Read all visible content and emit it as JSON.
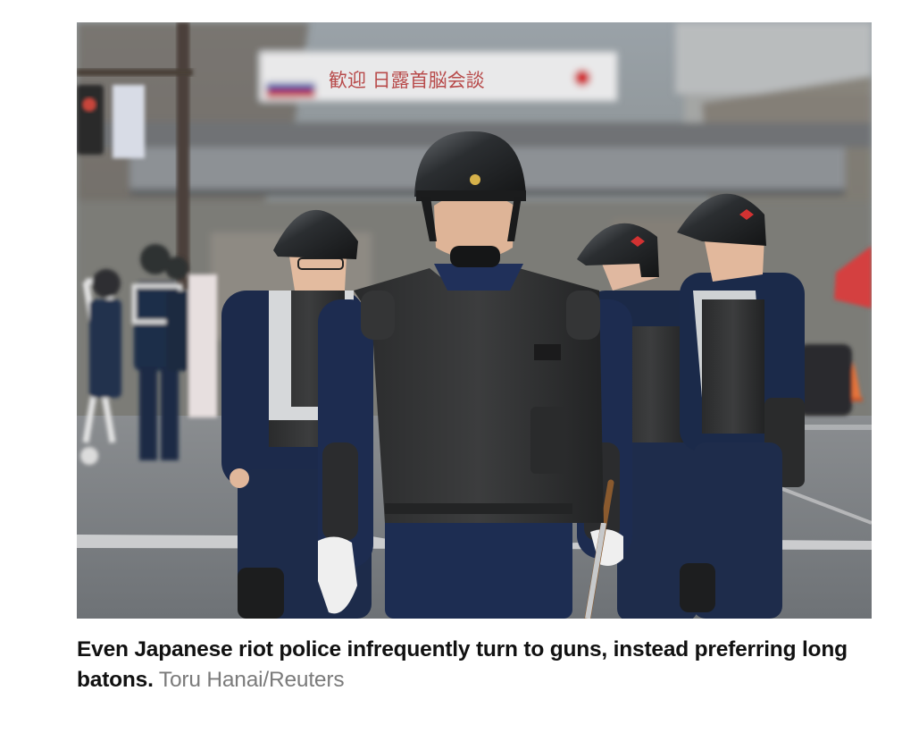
{
  "photo": {
    "banner_text": "歓迎 日露首脳会談"
  },
  "caption": {
    "text": "Even Japanese riot police infrequently turn to guns, instead preferring long batons.",
    "credit": "Toru Hanai/Reuters"
  }
}
